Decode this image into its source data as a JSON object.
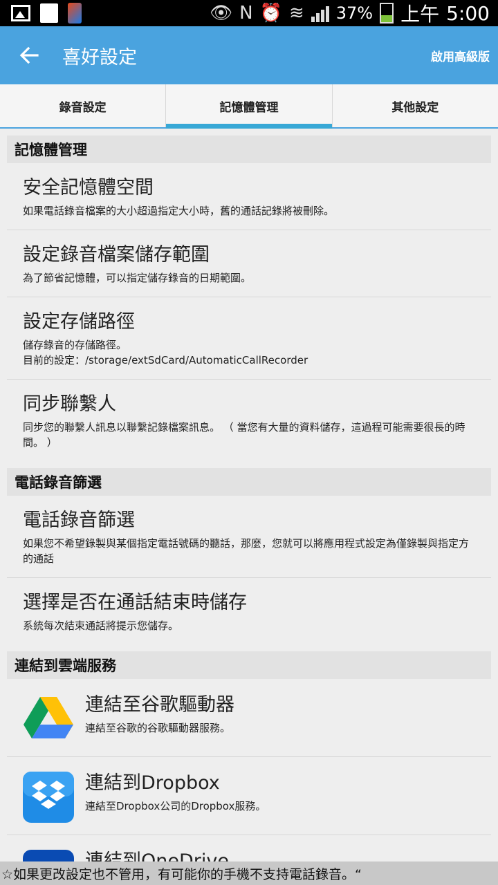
{
  "status_bar": {
    "battery": "37%",
    "ampm": "上午",
    "time": "5:00"
  },
  "app_bar": {
    "title": "喜好設定",
    "upgrade": "啟用高級版"
  },
  "tabs": [
    {
      "label": "錄音設定"
    },
    {
      "label": "記憶體管理",
      "active": true
    },
    {
      "label": "其他設定"
    }
  ],
  "sections": {
    "memory": {
      "header": "記憶體管理",
      "items": [
        {
          "title": "安全記憶體空間",
          "sub": "如果電話錄音檔案的大小超過指定大小時，舊的通話記錄將被刪除。"
        },
        {
          "title": "設定錄音檔案儲存範圍",
          "sub": "為了節省記憶體，可以指定儲存錄音的日期範圍。"
        },
        {
          "title": "設定存儲路徑",
          "sub": "儲存錄音的存儲路徑。",
          "sub2": "目前的設定：/storage/extSdCard/AutomaticCallRecorder"
        },
        {
          "title": "同步聯繫人",
          "sub": "同步您的聯繫人訊息以聯繫記錄檔案訊息。 （ 當您有大量的資料儲存，這過程可能需要很長的時間。 ）"
        }
      ]
    },
    "filter": {
      "header": "電話錄音篩選",
      "items": [
        {
          "title": "電話錄音篩選",
          "sub": "如果您不希望錄製與某個指定電話號碼的聽話，那麼，您就可以將應用程式設定為僅錄製與指定方的通話"
        },
        {
          "title": "選擇是否在通話結束時儲存",
          "sub": "系統每次結束通話將提示您儲存。"
        }
      ]
    },
    "cloud": {
      "header": "連結到雲端服務",
      "items": [
        {
          "title": "連結至谷歌驅動器",
          "sub": "連結至谷歌的谷歌驅動器服務。",
          "icon": "google-drive-icon"
        },
        {
          "title": "連結到Dropbox",
          "sub": "連結至Dropbox公司的Dropbox服務。",
          "icon": "dropbox-icon"
        },
        {
          "title": "連結到OneDrive",
          "sub": "",
          "icon": "onedrive-icon"
        }
      ]
    }
  },
  "footer": {
    "text": "☆如果更改設定也不管用，有可能你的手機不支持電話錄音。“"
  },
  "colors": {
    "app_bar": "#4aa3df",
    "tab_indicator": "#38a8d6",
    "section_header": "#e2e2e2",
    "footer": "#c8c8c8"
  }
}
